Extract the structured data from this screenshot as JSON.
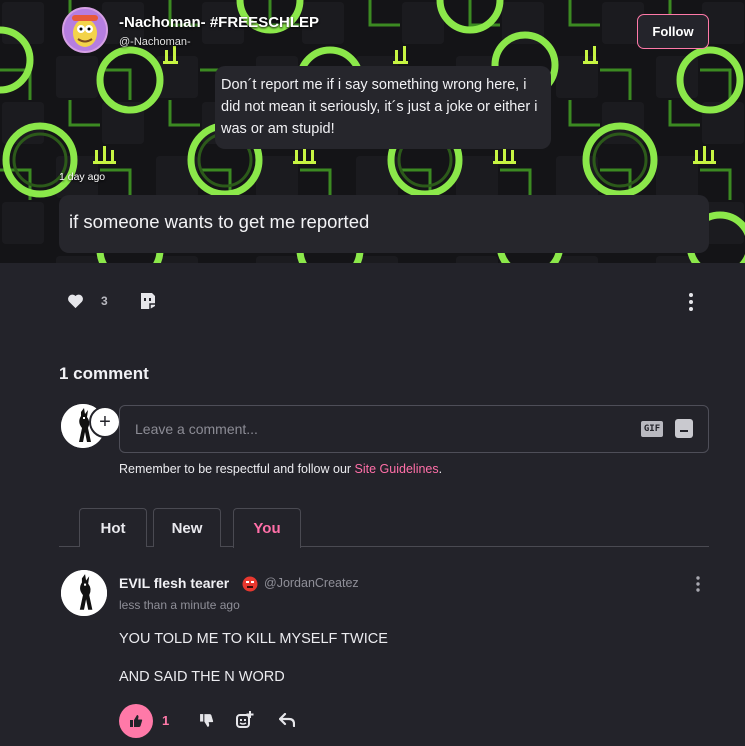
{
  "post": {
    "author_display_name": "-Nachoman- #FREESCHLEP",
    "author_handle": "@-Nachoman-",
    "follow_label": "Follow",
    "speech_text": "Don´t report me if i say something wrong here, i did not mean it seriously, it´s just a joke or either i was or am stupid!",
    "timestamp": "1 day ago",
    "title": "if someone wants to get me reported",
    "likes": "3",
    "icons": {
      "like": "heart-icon",
      "sticker": "sticker-icon",
      "more": "more-vertical-icon"
    }
  },
  "comments": {
    "count_label": "1 comment",
    "input_placeholder": "Leave a comment...",
    "gif_label": "GIF",
    "guidelines_prefix": "Remember to be respectful and follow our ",
    "guidelines_link": "Site Guidelines",
    "guidelines_suffix": ".",
    "tabs": [
      {
        "label": "Hot",
        "active": false
      },
      {
        "label": "New",
        "active": false
      },
      {
        "label": "You",
        "active": true
      }
    ],
    "items": [
      {
        "name": "EVIL flesh tearer",
        "handle": "@JordanCreatez",
        "time": "less than a minute ago",
        "lines": [
          "YOU TOLD ME TO KILL MYSELF TWICE",
          "AND SAID THE N WORD"
        ],
        "upvotes": "1"
      }
    ]
  },
  "colors": {
    "accent": "#ff79a8",
    "background": "#23232a",
    "banner_green": "#7cf04a"
  }
}
